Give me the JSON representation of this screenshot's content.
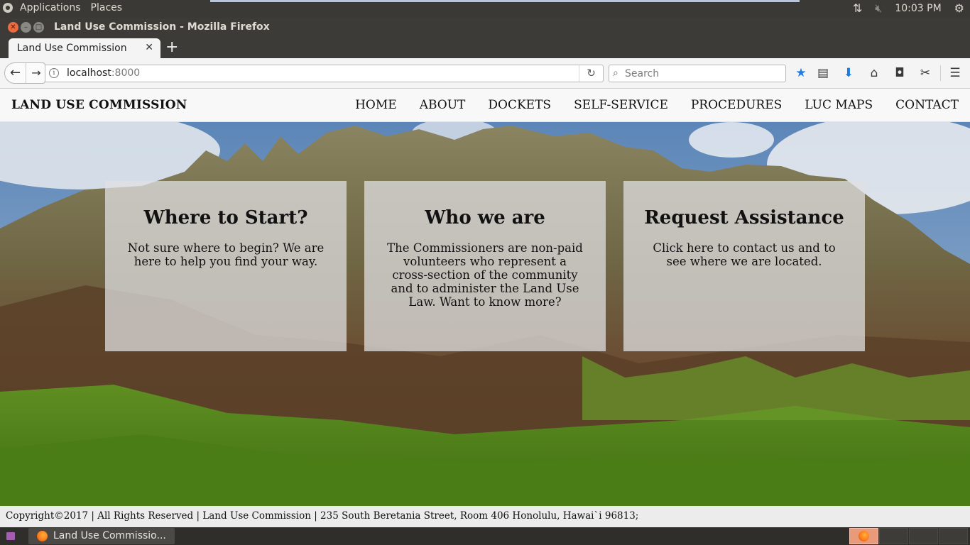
{
  "os_panel": {
    "applications": "Applications",
    "places": "Places",
    "clock": "10:03 PM"
  },
  "window": {
    "title": "Land Use Commission - Mozilla Firefox"
  },
  "tabs": [
    {
      "label": "Land Use Commission"
    }
  ],
  "address_bar": {
    "host": "localhost",
    "port": ":8000"
  },
  "search_bar": {
    "placeholder": "Search"
  },
  "site": {
    "brand": "LAND USE COMMISSION",
    "nav": [
      "HOME",
      "ABOUT",
      "DOCKETS",
      "SELF-SERVICE",
      "PROCEDURES",
      "LUC MAPS",
      "CONTACT"
    ],
    "cards": [
      {
        "title": "Where to Start?",
        "text": "Not sure where to begin? We are here to help you find your way."
      },
      {
        "title": "Who we are",
        "text": "The Commissioners are non-paid volunteers who represent a cross-section of the community and to administer the Land Use Law. Want to know more?"
      },
      {
        "title": "Request Assistance",
        "text": "Click here to contact us and to see where we are located."
      }
    ],
    "footer": "Copyright©2017 | All Rights Reserved | Land Use Commission | 235 South Beretania Street, Room 406 Honolulu, Hawai`i 96813;"
  },
  "taskbar": {
    "task_label": "Land Use Commissio..."
  }
}
